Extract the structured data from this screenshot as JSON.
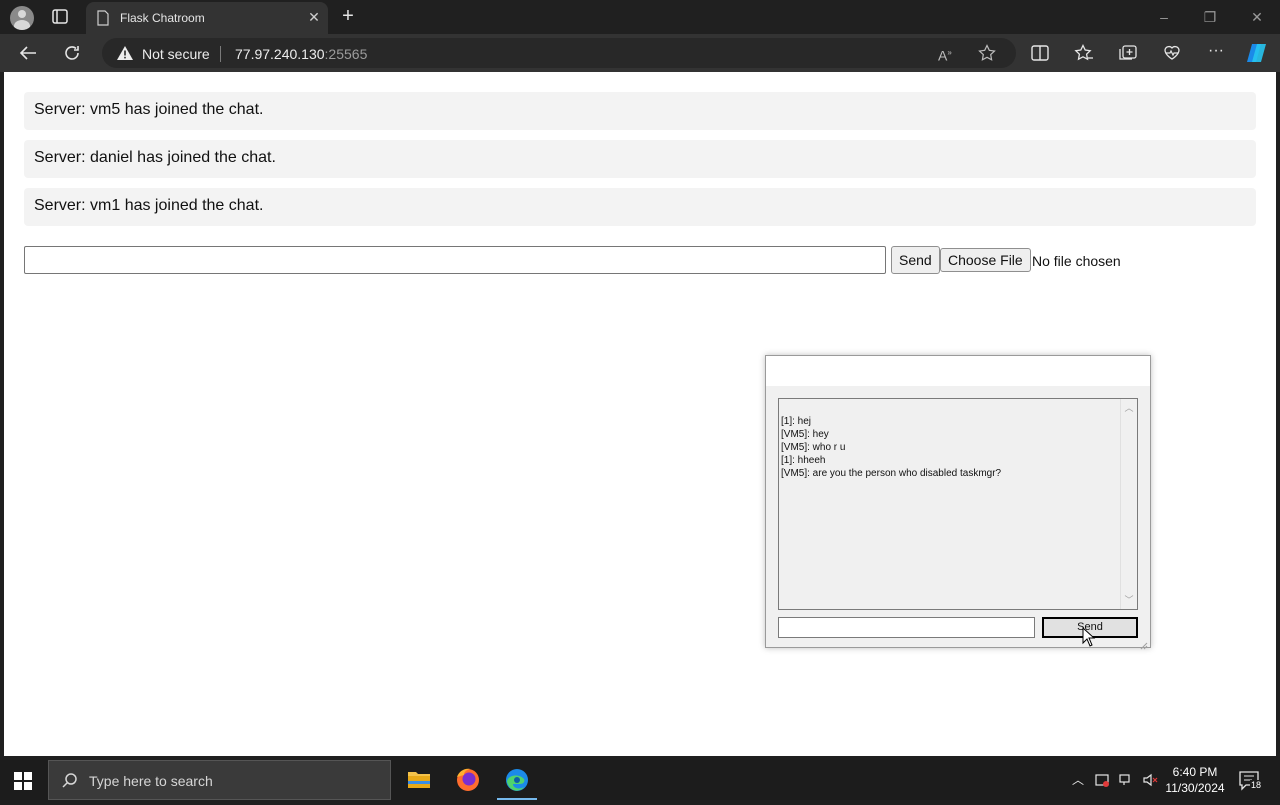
{
  "browser": {
    "tab_title": "Flask Chatroom",
    "security_label": "Not secure",
    "url_host": "77.97.240.130",
    "url_port": ":25565"
  },
  "page": {
    "messages": [
      "Server: vm5 has joined the chat.",
      "Server: daniel has joined the chat.",
      "Server: vm1 has joined the chat."
    ],
    "message_input_value": "",
    "send_label": "Send",
    "choose_file_label": "Choose File",
    "no_file_label": "No file chosen"
  },
  "chat_window": {
    "log": [
      "[1]: hej",
      "[VM5]: hey",
      "[VM5]: who r u",
      "[1]: hheeh",
      "[VM5]: are you the person who disabled taskmgr?"
    ],
    "input_value": "",
    "send_label": "Send"
  },
  "taskbar": {
    "search_placeholder": "Type here to search",
    "time": "6:40 PM",
    "date": "11/30/2024",
    "notification_count": "18",
    "apps": [
      "file-explorer",
      "firefox",
      "edge"
    ]
  },
  "icons": {
    "profile": "profile-icon",
    "warning": "warning-triangle-icon",
    "accent_blue": "#76b9ed"
  }
}
